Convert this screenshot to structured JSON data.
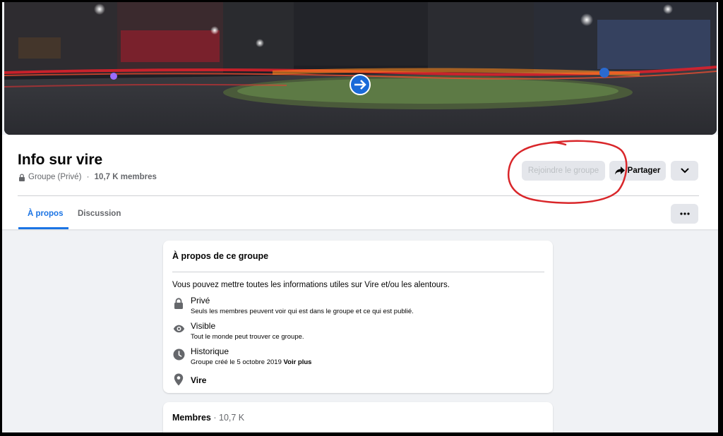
{
  "group": {
    "title": "Info sur vire",
    "privacy": "Groupe (Privé)",
    "separator": " · ",
    "members_count": "10,7 K membres"
  },
  "actions": {
    "join_label": "Rejoindre le groupe",
    "share_label": "Partager",
    "share_icon": "share-arrow-icon",
    "more_icon": "dropdown-chevron-icon",
    "menu_icon": "more-dots-icon"
  },
  "tabs": [
    {
      "label": "À propos",
      "active": true
    },
    {
      "label": "Discussion",
      "active": false
    }
  ],
  "about": {
    "title": "À propos de ce groupe",
    "description": "Vous pouvez mettre toutes les informations utiles sur Vire et/ou les alentours.",
    "items": [
      {
        "icon": "lock-icon",
        "title": "Privé",
        "subtitle": "Seuls les membres peuvent voir qui est dans le groupe et ce qui est publié."
      },
      {
        "icon": "eye-icon",
        "title": "Visible",
        "subtitle": "Tout le monde peut trouver ce groupe."
      },
      {
        "icon": "clock-icon",
        "title": "Historique",
        "subtitle": "Groupe créé le 5 octobre 2019",
        "link": "Voir plus"
      },
      {
        "icon": "location-pin-icon",
        "title": "Vire"
      }
    ]
  },
  "members": {
    "label": "Membres",
    "separator": " · ",
    "count": "10,7 K"
  },
  "colors": {
    "accent": "#1b74e4",
    "annotation": "#d9262a",
    "background": "#f0f2f5"
  }
}
